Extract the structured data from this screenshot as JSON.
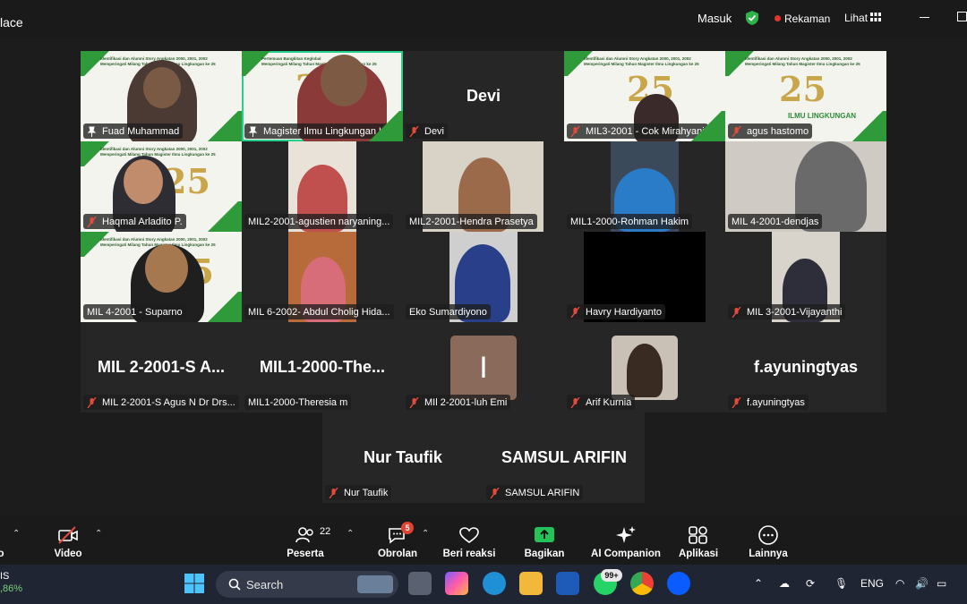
{
  "window": {
    "title": "lace"
  },
  "topbar": {
    "signin": "Masuk",
    "recording": "Rekaman",
    "view": "Lihat"
  },
  "tiles": [
    {
      "name": "Fuad Muhammad",
      "type": "video"
    },
    {
      "name": "Magister Ilmu Lingkungan U...",
      "type": "video"
    },
    {
      "name": "Devi",
      "big": "Devi",
      "type": "name"
    },
    {
      "name": "MIL3-2001 - Cok Mirahyani",
      "type": "video"
    },
    {
      "name": "agus hastomo",
      "type": "video"
    },
    {
      "name": "Haqmal Arladito P.",
      "type": "video"
    },
    {
      "name": "MIL2-2001-agustien naryaning...",
      "type": "video"
    },
    {
      "name": "MIL2-2001-Hendra Prasetya",
      "type": "video"
    },
    {
      "name": "MIL1-2000-Rohman Hakim",
      "type": "video"
    },
    {
      "name": "MIL 4-2001-dendjas",
      "type": "video"
    },
    {
      "name": "MIL 4-2001 - Suparno",
      "type": "video"
    },
    {
      "name": "MIL 6-2002- Abdul Cholig Hida...",
      "type": "video"
    },
    {
      "name": "Eko Sumardiyono",
      "type": "video"
    },
    {
      "name": "Havry Hardiyanto",
      "type": "video"
    },
    {
      "name": "MIL 3-2001-Vijayanthi",
      "type": "video"
    },
    {
      "name": "MIL 2-2001-S Agus N Dr Drs...",
      "big": "MIL 2-2001-S A...",
      "type": "name"
    },
    {
      "name": "MIL1-2000-Theresia m",
      "big": "MIL1-2000-The...",
      "type": "name"
    },
    {
      "name": "MIl 2-2001-luh Emi",
      "big": "I",
      "type": "avatar"
    },
    {
      "name": "Arif Kurnia",
      "type": "video"
    },
    {
      "name": "f.ayuningtyas",
      "big": "f.ayuningtyas",
      "type": "name"
    },
    {
      "name": "Nur Taufik",
      "big": "Nur Taufik",
      "type": "name"
    },
    {
      "name": "SAMSUL ARIFIN",
      "big": "SAMSUL ARIFIN",
      "type": "name"
    }
  ],
  "banner": {
    "line1": "Identifikasi dan Alumni Story Angkatan 2000, 2001, 2002",
    "line2": "Memperingati Milang Tahun Magister Ilmu Lingkungan ke 25",
    "line3": "Pertemuan Bangkitan Keglobal",
    "number": "25",
    "subtitle": "ILMU LINGKUNGAN"
  },
  "toolbar": {
    "audio_label": "o",
    "video_label": "Video",
    "participants_label": "Peserta",
    "participants_count": "22",
    "chat_label": "Obrolan",
    "chat_badge": "5",
    "reactions_label": "Beri reaksi",
    "share_label": "Bagikan",
    "ai_label": "AI Companion",
    "apps_label": "Aplikasi",
    "more_label": "Lainnya"
  },
  "taskbar": {
    "left_top": "IS",
    "left_bottom": ",86%",
    "search_placeholder": "Search",
    "whatsapp_badge": "99+",
    "language": "ENG"
  }
}
